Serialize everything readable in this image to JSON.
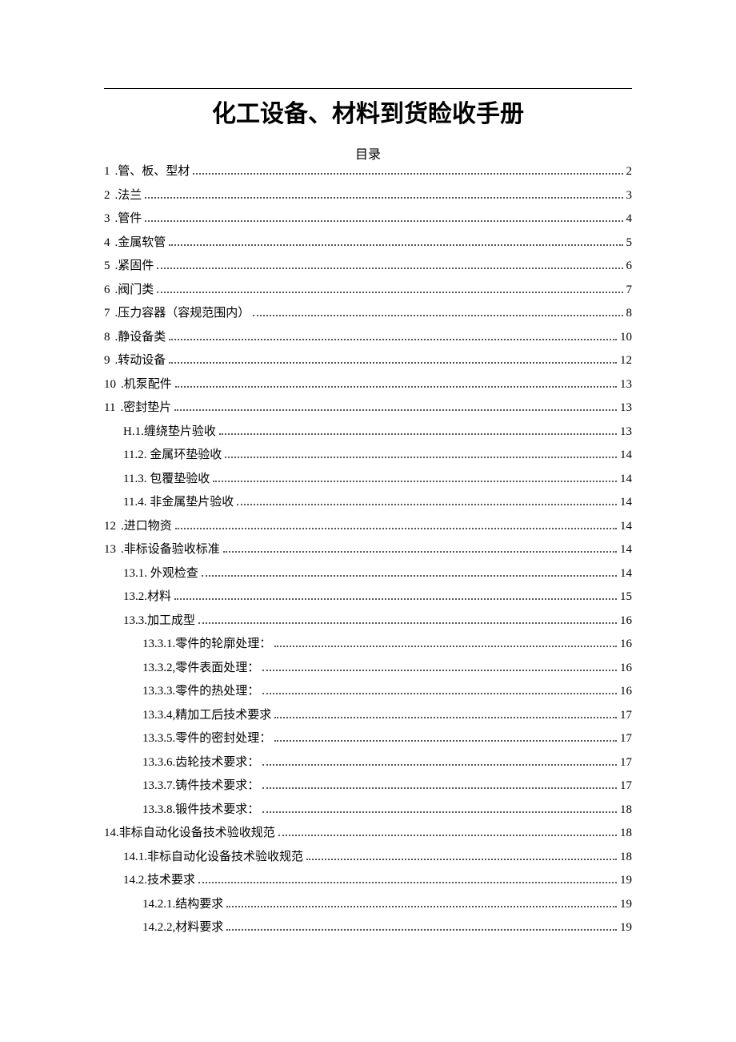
{
  "title": "化工设备、材料到货睑收手册",
  "toc_title": "目录",
  "toc": [
    {
      "num": "1",
      "label": ".管、板、型材",
      "page": "2",
      "indent": 0
    },
    {
      "num": "2",
      "label": ".法兰",
      "page": "3",
      "indent": 0
    },
    {
      "num": "3",
      "label": ".管件",
      "page": "4",
      "indent": 0
    },
    {
      "num": "4",
      "label": ".金属软管",
      "page": "5",
      "indent": 0
    },
    {
      "num": "5",
      "label": ".紧固件",
      "page": "6",
      "indent": 0
    },
    {
      "num": "6",
      "label": ".阀门类",
      "page": "7",
      "indent": 0
    },
    {
      "num": "7",
      "label": ".压力容器（容规范围内）",
      "page": "8",
      "indent": 0
    },
    {
      "num": "8",
      "label": ".静设备类",
      "page": "10",
      "indent": 0
    },
    {
      "num": "9",
      "label": ".转动设备",
      "page": "12",
      "indent": 0
    },
    {
      "num": "10",
      "label": "  .机泵配件",
      "page": "13",
      "indent": 0
    },
    {
      "num": "11",
      "label": "  .密封垫片",
      "page": "13",
      "indent": 0
    },
    {
      "num": "",
      "label": "H.1.缠绕垫片验收",
      "page": "13",
      "indent": 1
    },
    {
      "num": "",
      "label": "11.2.    金属环垫验收",
      "page": "14",
      "indent": 1
    },
    {
      "num": "",
      "label": "11.3.    包覆垫验收",
      "page": "14",
      "indent": 1
    },
    {
      "num": "",
      "label": "11.4.    非金属垫片验收",
      "page": "14",
      "indent": 1
    },
    {
      "num": "12",
      "label": "  .进口物资",
      "page": "14",
      "indent": 0
    },
    {
      "num": "13",
      "label": "  .非标设备验收标准",
      "page": "14",
      "indent": 0
    },
    {
      "num": "",
      "label": "13.1.    外观检查",
      "page": "14",
      "indent": 1
    },
    {
      "num": "",
      "label": "13.2.材料",
      "page": "15",
      "indent": 1
    },
    {
      "num": "",
      "label": "13.3.加工成型",
      "page": "16",
      "indent": 1
    },
    {
      "num": "",
      "label": "13.3.1.零件的轮廓处理：",
      "page": "16",
      "indent": 2
    },
    {
      "num": "",
      "label": "13.3.2,零件表面处理：",
      "page": "16",
      "indent": 2
    },
    {
      "num": "",
      "label": "13.3.3.零件的热处理：",
      "page": "16",
      "indent": 2
    },
    {
      "num": "",
      "label": "13.3.4,精加工后技术要求",
      "page": "17",
      "indent": 2
    },
    {
      "num": "",
      "label": "13.3.5.零件的密封处理：",
      "page": "17",
      "indent": 2
    },
    {
      "num": "",
      "label": "13.3.6.齿轮技术要求：",
      "page": "17",
      "indent": 2
    },
    {
      "num": "",
      "label": "13.3.7.铸件技术要求：",
      "page": "17",
      "indent": 2
    },
    {
      "num": "",
      "label": "13.3.8.锻件技术要求：",
      "page": "18",
      "indent": 2
    },
    {
      "num": "",
      "label": "14.非标自动化设备技术验收规范",
      "page": "18",
      "indent": 0
    },
    {
      "num": "",
      "label": "14.1.非标自动化设备技术验收规范",
      "page": "18",
      "indent": 1
    },
    {
      "num": "",
      "label": "14.2.技术要求",
      "page": "19",
      "indent": 1
    },
    {
      "num": "",
      "label": "14.2.1.结构要求",
      "page": "19",
      "indent": 2
    },
    {
      "num": "",
      "label": "14.2.2,材料要求",
      "page": "19",
      "indent": 2
    }
  ]
}
